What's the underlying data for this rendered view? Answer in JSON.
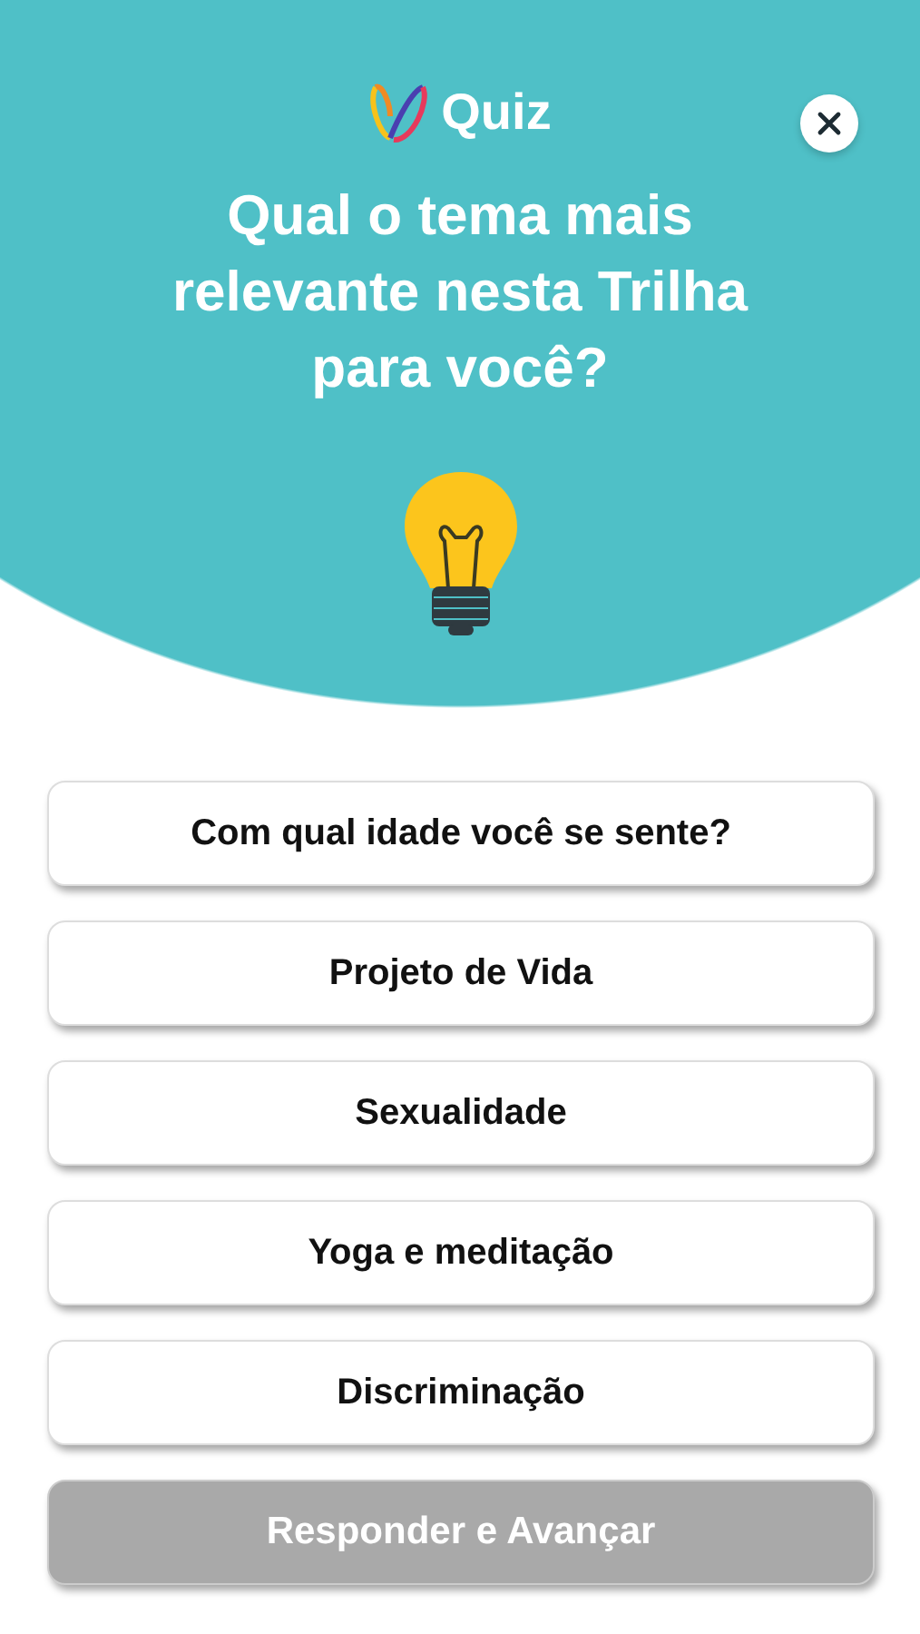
{
  "header": {
    "logo_text": "Quiz",
    "question": "Qual o tema mais relevante nesta Trilha para você?"
  },
  "options": [
    {
      "label": "Com qual idade você se sente?",
      "selected": false
    },
    {
      "label": "Projeto de Vida",
      "selected": false
    },
    {
      "label": "Sexualidade",
      "selected": false
    },
    {
      "label": "Yoga e meditação",
      "selected": false
    },
    {
      "label": "Discriminação",
      "selected": false
    }
  ],
  "submit": {
    "label": "Responder e Avançar",
    "disabled": true
  }
}
